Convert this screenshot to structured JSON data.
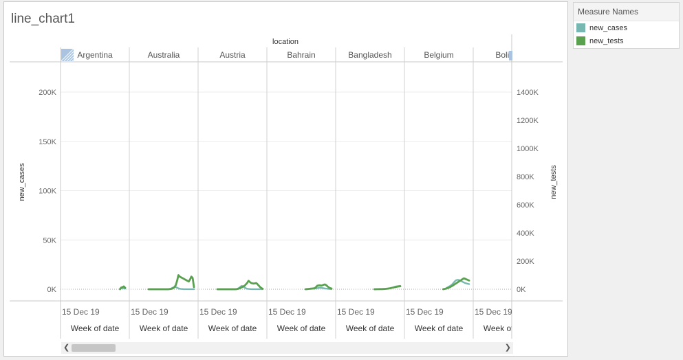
{
  "view": {
    "title": "line_chart1"
  },
  "legend": {
    "title": "Measure Names",
    "items": [
      {
        "label": "new_cases",
        "color": "#76b7b2"
      },
      {
        "label": "new_tests",
        "color": "#59a14f"
      }
    ]
  },
  "chart_data": {
    "type": "line",
    "column_header": "location",
    "panes": [
      "Argentina",
      "Australia",
      "Austria",
      "Bahrain",
      "Bangladesh",
      "Belgium",
      "Bolivia"
    ],
    "x_tick_label": "15 Dec 19",
    "xlabel": "Week of date",
    "y_left": {
      "label": "new_cases",
      "ticks": [
        "0K",
        "50K",
        "100K",
        "150K",
        "200K"
      ],
      "ylim": [
        0,
        230000
      ]
    },
    "y_right": {
      "label": "new_tests",
      "ticks": [
        "0K",
        "200K",
        "400K",
        "600K",
        "800K",
        "1000K",
        "1200K",
        "1400K"
      ],
      "ylim": [
        0,
        1610000
      ]
    },
    "weeks": [
      0,
      1,
      2,
      3,
      4,
      5,
      6,
      7,
      8,
      9,
      10,
      11,
      12,
      13,
      14,
      15,
      16,
      17,
      18,
      19,
      20,
      21,
      22,
      23,
      24,
      25,
      26,
      27,
      28,
      29,
      30,
      31,
      32,
      33,
      34,
      35
    ],
    "series": [
      {
        "name": "new_cases",
        "color": "#76b7b2",
        "axis": "left",
        "values": [
          [
            null,
            null,
            null,
            null,
            null,
            null,
            null,
            null,
            null,
            null,
            null,
            null,
            null,
            null,
            null,
            null,
            null,
            null,
            null,
            null,
            null,
            null,
            null,
            null,
            null,
            null,
            null,
            null,
            null,
            null,
            null,
            500,
            1000,
            1200,
            800,
            600
          ],
          [
            0,
            0,
            0,
            0,
            0,
            0,
            0,
            0,
            0,
            0,
            0,
            0,
            0,
            0,
            0,
            0,
            200,
            500,
            1200,
            1800,
            2400,
            2200,
            1500,
            900,
            500,
            300,
            200,
            100,
            100,
            100,
            100,
            100,
            100,
            100,
            100,
            100
          ],
          [
            0,
            0,
            0,
            0,
            0,
            0,
            0,
            0,
            0,
            0,
            0,
            0,
            0,
            0,
            0,
            200,
            800,
            1600,
            2800,
            3400,
            2600,
            1700,
            1000,
            500,
            300,
            200,
            100,
            100,
            100,
            100,
            100,
            100,
            100,
            100,
            100,
            100
          ],
          [
            null,
            null,
            null,
            null,
            null,
            null,
            null,
            null,
            null,
            null,
            null,
            null,
            null,
            null,
            null,
            0,
            100,
            200,
            300,
            400,
            500,
            600,
            700,
            900,
            1100,
            1300,
            1500,
            1400,
            1200,
            1000,
            800,
            600,
            500,
            300,
            200,
            100
          ],
          [
            null,
            null,
            null,
            null,
            null,
            null,
            null,
            null,
            null,
            null,
            null,
            null,
            null,
            null,
            null,
            0,
            100,
            100,
            100,
            100,
            200,
            200,
            300,
            300,
            400,
            600,
            800,
            1000,
            1300,
            1700,
            2100,
            2600,
            2900,
            3100,
            3300,
            3400
          ],
          [
            null,
            null,
            null,
            null,
            null,
            null,
            null,
            null,
            null,
            null,
            null,
            null,
            null,
            null,
            null,
            0,
            300,
            800,
            1500,
            2300,
            3100,
            3900,
            5000,
            6500,
            8100,
            9100,
            9500,
            9400,
            9000,
            8300,
            7500,
            6800,
            6300,
            5900,
            5500,
            5200
          ]
        ]
      },
      {
        "name": "new_tests",
        "color": "#59a14f",
        "axis": "right",
        "values": [
          [
            null,
            null,
            null,
            null,
            null,
            null,
            null,
            null,
            null,
            null,
            null,
            null,
            null,
            null,
            null,
            null,
            null,
            null,
            null,
            null,
            null,
            null,
            null,
            null,
            null,
            null,
            null,
            null,
            null,
            null,
            null,
            0,
            12000,
            15000,
            20000,
            10000
          ],
          [
            0,
            0,
            0,
            0,
            0,
            0,
            0,
            0,
            0,
            0,
            0,
            0,
            0,
            0,
            0,
            0,
            1000,
            2000,
            4000,
            8000,
            15000,
            30000,
            60000,
            100000,
            90000,
            85000,
            80000,
            75000,
            70000,
            65000,
            60000,
            55000,
            70000,
            90000,
            80000,
            15000
          ],
          [
            0,
            0,
            0,
            0,
            0,
            0,
            0,
            0,
            0,
            0,
            0,
            0,
            0,
            0,
            0,
            1000,
            3000,
            6000,
            10000,
            15000,
            20000,
            25000,
            35000,
            45000,
            60000,
            52000,
            45000,
            42000,
            40000,
            42000,
            44000,
            35000,
            25000,
            15000,
            8000,
            3000
          ],
          [
            null,
            null,
            null,
            null,
            null,
            null,
            null,
            null,
            null,
            null,
            null,
            null,
            null,
            null,
            null,
            0,
            1000,
            2000,
            3000,
            4000,
            5000,
            6000,
            7000,
            15000,
            25000,
            27000,
            28000,
            26000,
            28000,
            32000,
            34000,
            28000,
            20000,
            12000,
            8000,
            5000
          ],
          [
            null,
            null,
            null,
            null,
            null,
            null,
            null,
            null,
            null,
            null,
            null,
            null,
            null,
            null,
            null,
            0,
            200,
            400,
            600,
            800,
            1000,
            1200,
            1500,
            2000,
            3000,
            4000,
            5500,
            7000,
            9000,
            11000,
            13000,
            15000,
            17000,
            19000,
            20000,
            21000
          ],
          [
            null,
            null,
            null,
            null,
            null,
            null,
            null,
            null,
            null,
            null,
            null,
            null,
            null,
            null,
            null,
            0,
            2000,
            4000,
            7000,
            10000,
            14000,
            19000,
            24000,
            30000,
            36000,
            42000,
            48000,
            54000,
            60000,
            66000,
            72000,
            78000,
            74000,
            70000,
            66000,
            62000
          ]
        ]
      }
    ],
    "grid": true,
    "legend_position": "right"
  }
}
